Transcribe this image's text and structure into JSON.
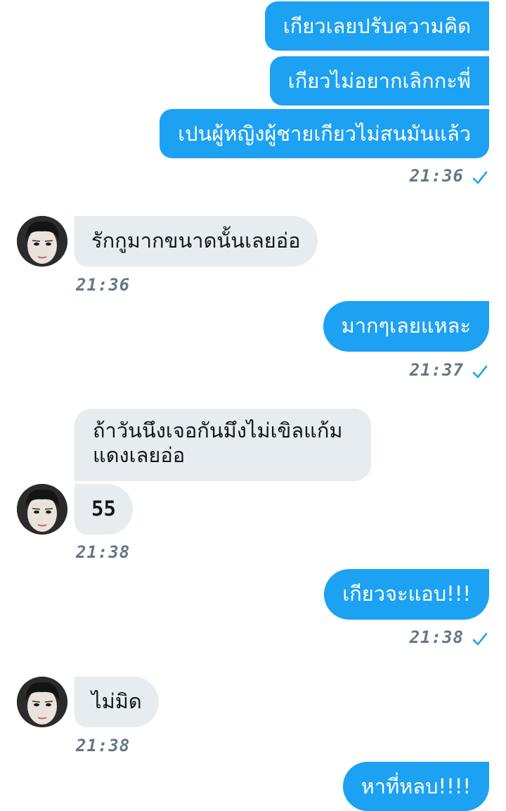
{
  "colors": {
    "outgoing_bubble": "#1da1f2",
    "incoming_bubble": "#e6ecf0",
    "timestamp": "#657786",
    "read_check": "#1da1f2"
  },
  "messages": {
    "m1": "เกียวเลยปรับความคิด",
    "m2": "เกียวไม่อยากเลิกกะพี่",
    "m3": "เปนผู้หญิงผู้ชายเกียวไม่สนมันแล้ว",
    "t1": "21:36",
    "m4": "รักกูมากขนาดนั้นเลยอ่อ",
    "t2": "21:36",
    "m5": "มากๆเลยแหละ",
    "t3": "21:37",
    "m6": "ถ้าวันนึงเจอกันมึงไม่เขิลแก้มแดงเลยอ่อ",
    "m7": "55",
    "t4": "21:38",
    "m8": "เกียวจะแอบ!!!",
    "t5": "21:38",
    "m9": "ไม่มิด",
    "t6": "21:38",
    "m10": "หาที่หลบ!!!!"
  },
  "icons": {
    "read_receipt": "check-icon",
    "contact_avatar": "avatar"
  }
}
